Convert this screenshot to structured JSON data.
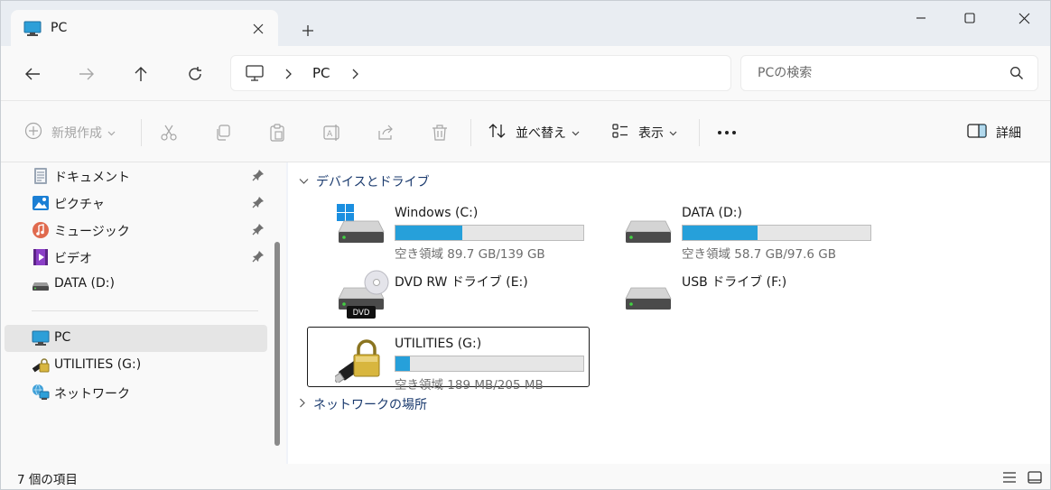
{
  "tab": {
    "title": "PC"
  },
  "address": {
    "crumb": "PC"
  },
  "search": {
    "placeholder": "PCの検索"
  },
  "commands": {
    "new_label": "新規作成",
    "sort_label": "並べ替え",
    "view_label": "表示",
    "details_label": "詳細"
  },
  "sidebar": {
    "items": [
      {
        "label": "ドキュメント",
        "icon": "document-icon",
        "pinned": true
      },
      {
        "label": "ピクチャ",
        "icon": "pictures-icon",
        "pinned": true
      },
      {
        "label": "ミュージック",
        "icon": "music-icon",
        "pinned": true
      },
      {
        "label": "ビデオ",
        "icon": "video-icon",
        "pinned": true
      },
      {
        "label": "DATA (D:)",
        "icon": "drive-icon",
        "pinned": false
      },
      {
        "label": "PC",
        "icon": "pc-icon",
        "selected": true
      },
      {
        "label": "UTILITIES (G:)",
        "icon": "usb-lock-icon"
      },
      {
        "label": "ネットワーク",
        "icon": "network-icon"
      }
    ]
  },
  "sections": {
    "devices": "デバイスとドライブ",
    "network": "ネットワークの場所"
  },
  "drives": [
    {
      "name": "Windows (C:)",
      "free_text": "空き領域 89.7 GB/139 GB",
      "used_fraction": 0.355
    },
    {
      "name": "DATA (D:)",
      "free_text": "空き領域 58.7 GB/97.6 GB",
      "used_fraction": 0.399
    },
    {
      "name": "DVD RW ドライブ (E:)",
      "badge": "DVD"
    },
    {
      "name": "USB ドライブ (F:)"
    },
    {
      "name": "UTILITIES (G:)",
      "free_text": "空き領域 189 MB/205 MB",
      "used_fraction": 0.078
    }
  ],
  "status": {
    "text": "7 個の項目"
  },
  "colors": {
    "accent": "#26a0da",
    "selection": "#e5e5e5"
  }
}
